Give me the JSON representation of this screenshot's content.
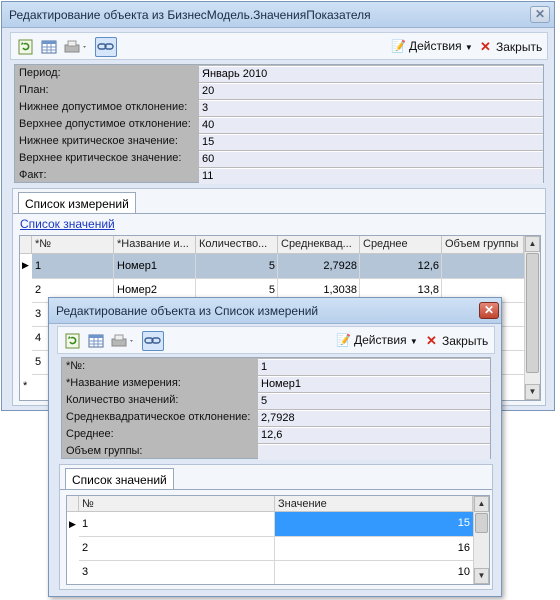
{
  "main": {
    "title": "Редактирование объекта  из БизнесМодель.ЗначенияПоказателя",
    "toolbar": {
      "actions_label": "Действия",
      "close_label": "Закрыть"
    },
    "props": [
      {
        "label": "Период:",
        "value": "Январь 2010"
      },
      {
        "label": "План:",
        "value": "20"
      },
      {
        "label": "Нижнее допустимое отклонение:",
        "value": "3"
      },
      {
        "label": "Верхнее допустимое отклонение:",
        "value": "40"
      },
      {
        "label": "Нижнее критическое значение:",
        "value": "15"
      },
      {
        "label": "Верхнее критическое значение:",
        "value": "60"
      },
      {
        "label": "Факт:",
        "value": "11"
      }
    ],
    "tab_label": "Список измерений",
    "link_label": "Список значений",
    "grid": {
      "headers": [
        "*№",
        "*Название и...",
        "Количество...",
        "Среднеквад...",
        "Среднее",
        "Объем группы"
      ],
      "rows": [
        [
          "1",
          "Номер1",
          "5",
          "2,7928",
          "12,6",
          ""
        ],
        [
          "2",
          "Номер2",
          "5",
          "1,3038",
          "13,8",
          ""
        ],
        [
          "3",
          "",
          "",
          "",
          "",
          ""
        ],
        [
          "4",
          "",
          "",
          "",
          "",
          ""
        ],
        [
          "5",
          "",
          "",
          "",
          "",
          ""
        ]
      ],
      "new_row_marker": "*"
    }
  },
  "dialog": {
    "title": "Редактирование объекта  из Список измерений",
    "toolbar": {
      "actions_label": "Действия",
      "close_label": "Закрыть"
    },
    "props": [
      {
        "label": "*№:",
        "value": "1"
      },
      {
        "label": "*Название измерения:",
        "value": "Номер1"
      },
      {
        "label": "Количество значений:",
        "value": "5"
      },
      {
        "label": "Среднеквадратическое отклонение:",
        "value": "2,7928"
      },
      {
        "label": "Среднее:",
        "value": "12,6"
      },
      {
        "label": "Объем группы:",
        "value": ""
      }
    ],
    "tab_label": "Список значений",
    "grid": {
      "headers": [
        "№",
        "Значение"
      ],
      "rows": [
        [
          "1",
          "15"
        ],
        [
          "2",
          "16"
        ],
        [
          "3",
          "10"
        ]
      ]
    }
  },
  "icons": {
    "refresh": "refresh-icon",
    "table": "table-icon",
    "print": "printer-icon",
    "link": "link-icon",
    "actions": "edit-document-icon",
    "close": "close-x-icon"
  },
  "colors": {
    "title_bar": "#b8d0ec",
    "selection": "#3399ff",
    "link": "#1b39c4",
    "close_red": "#d5281b"
  }
}
